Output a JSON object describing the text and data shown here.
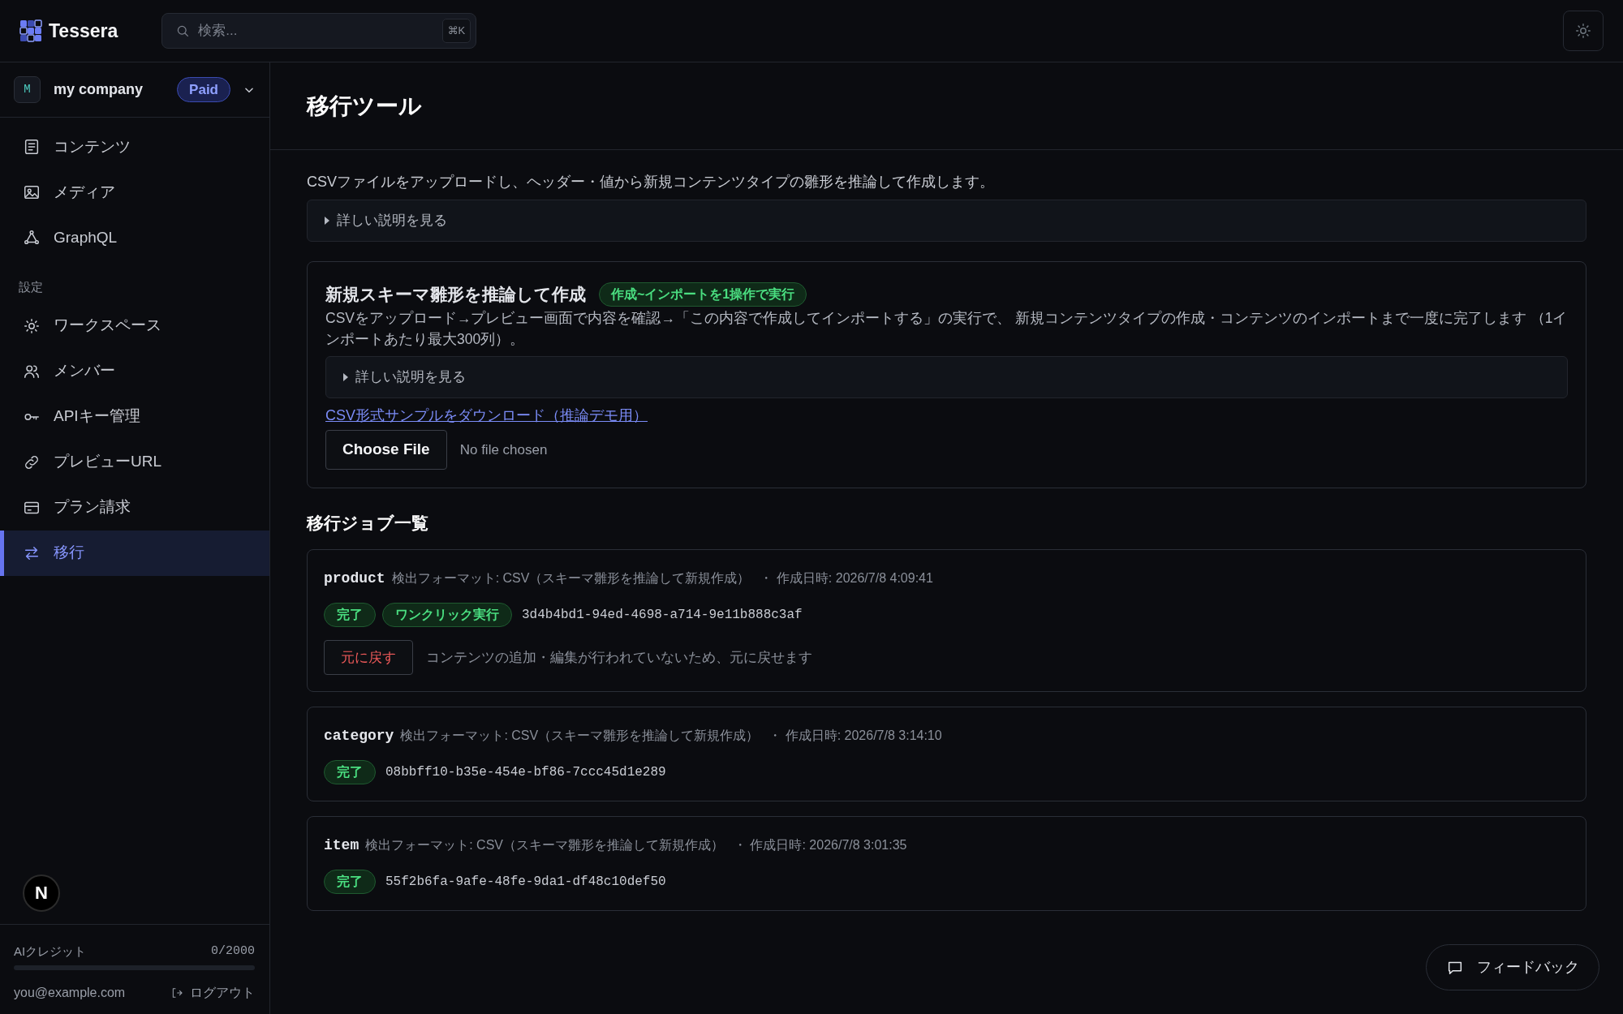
{
  "app": {
    "name": "Tessera"
  },
  "search": {
    "placeholder": "検索...",
    "shortcut": "⌘K"
  },
  "workspace": {
    "initial": "M",
    "name": "my company",
    "plan": "Paid"
  },
  "sidebar": {
    "items": [
      {
        "label": "コンテンツ",
        "selected": false
      },
      {
        "label": "メディア",
        "selected": false
      },
      {
        "label": "GraphQL",
        "selected": false
      }
    ],
    "section_label": "設定",
    "settings_items": [
      {
        "label": "ワークスペース",
        "selected": false
      },
      {
        "label": "メンバー",
        "selected": false
      },
      {
        "label": "APIキー管理",
        "selected": false
      },
      {
        "label": "プレビューURL",
        "selected": false
      },
      {
        "label": "プラン請求",
        "selected": false
      },
      {
        "label": "移行",
        "selected": true
      }
    ]
  },
  "credits": {
    "label": "AIクレジット",
    "reading": "0/2000",
    "level": 0
  },
  "user": {
    "email": "you@example.com",
    "logout": "ログアウト"
  },
  "dev_indicator": {
    "label": "N"
  },
  "page": {
    "title": "移行ツール",
    "description": "CSVファイルをアップロードし、ヘッダー・値から新規コンテンツタイプの雛形を推論して作成します。",
    "details": {
      "label": "詳しい説明を見る",
      "expanded": false
    }
  },
  "infer_card": {
    "title": "新規スキーマ雛形を推論して作成",
    "tag": "作成~インポートを1操作で実行",
    "description": "CSVをアップロード→プレビュー画面で内容を確認→「この内容で作成してインポートする」の実行で、 新規コンテンツタイプの作成・コンテンツのインポートまで一度に完了します （1インポートあたり最大300列）。",
    "details": {
      "label": "詳しい説明を見る",
      "expanded": false
    },
    "sample_link": "CSV形式サンプルをダウンロード（推論デモ用）",
    "file_button": "Choose File",
    "file_status": "No file chosen"
  },
  "jobs_title": "移行ジョブ一覧",
  "jobs": [
    {
      "name": "product",
      "meta": "検出フォーマット: CSV（スキーマ雛形を推論して新規作成）",
      "date": "・ 作成日時: 2026/7/8 4:09:41",
      "badges": [
        "完了",
        "ワンクリック実行"
      ],
      "id": "3d4b4bd1-94ed-4698-a714-9e11b888c3af",
      "revert": {
        "label": "元に戻す",
        "note": "コンテンツの追加・編集が行われていないため、元に戻せます"
      }
    },
    {
      "name": "category",
      "meta": "検出フォーマット: CSV（スキーマ雛形を推論して新規作成）",
      "date": "・ 作成日時: 2026/7/8 3:14:10",
      "badges": [
        "完了"
      ],
      "id": "08bbff10-b35e-454e-bf86-7ccc45d1e289"
    },
    {
      "name": "item",
      "meta": "検出フォーマット: CSV（スキーマ雛形を推論して新規作成）",
      "date": "・ 作成日時: 2026/7/8 3:01:35",
      "badges": [
        "完了"
      ],
      "id": "55f2b6fa-9afe-48fe-9da1-df48c10def50"
    }
  ],
  "feedback": {
    "label": "フィードバック"
  }
}
